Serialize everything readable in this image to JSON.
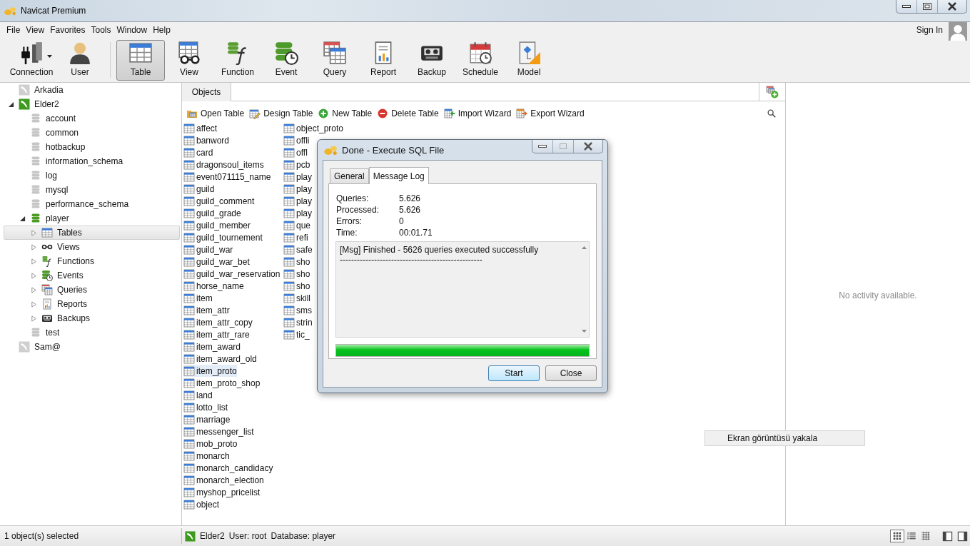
{
  "window": {
    "title": "Navicat Premium"
  },
  "menu": [
    "File",
    "View",
    "Favorites",
    "Tools",
    "Window",
    "Help"
  ],
  "account": {
    "label": "Sign In"
  },
  "toolbar": [
    {
      "kind": "connection",
      "label": "Connection",
      "selected": false,
      "dropdown": true
    },
    {
      "kind": "user",
      "label": "User",
      "selected": false,
      "dropdown": false
    },
    {
      "kind": "table",
      "label": "Table",
      "selected": true,
      "dropdown": false
    },
    {
      "kind": "view",
      "label": "View",
      "selected": false,
      "dropdown": false
    },
    {
      "kind": "function",
      "label": "Function",
      "selected": false,
      "dropdown": false
    },
    {
      "kind": "event",
      "label": "Event",
      "selected": false,
      "dropdown": false
    },
    {
      "kind": "query",
      "label": "Query",
      "selected": false,
      "dropdown": false
    },
    {
      "kind": "report",
      "label": "Report",
      "selected": false,
      "dropdown": false
    },
    {
      "kind": "backup",
      "label": "Backup",
      "selected": false,
      "dropdown": false
    },
    {
      "kind": "schedule",
      "label": "Schedule",
      "selected": false,
      "dropdown": false
    },
    {
      "kind": "model",
      "label": "Model",
      "selected": false,
      "dropdown": false
    }
  ],
  "tree": [
    {
      "kind": "server",
      "label": "Arkadia",
      "open": false,
      "selected": false
    },
    {
      "kind": "server",
      "label": "Elder2",
      "open": true,
      "expanded": true,
      "selected": false,
      "children": [
        {
          "kind": "database",
          "label": "account",
          "open": false,
          "selected": false
        },
        {
          "kind": "database",
          "label": "common",
          "open": false,
          "selected": false
        },
        {
          "kind": "database",
          "label": "hotbackup",
          "open": false,
          "selected": false
        },
        {
          "kind": "database",
          "label": "information_schema",
          "open": false,
          "selected": false
        },
        {
          "kind": "database",
          "label": "log",
          "open": false,
          "selected": false
        },
        {
          "kind": "database",
          "label": "mysql",
          "open": false,
          "selected": false
        },
        {
          "kind": "database",
          "label": "performance_schema",
          "open": false,
          "selected": false
        },
        {
          "kind": "database",
          "label": "player",
          "open": true,
          "expanded": true,
          "selected": false,
          "children": [
            {
              "kind": "tables",
              "label": "Tables",
              "expanded": false,
              "selected": true
            },
            {
              "kind": "views",
              "label": "Views",
              "expanded": false,
              "selected": false
            },
            {
              "kind": "functions",
              "label": "Functions",
              "expanded": false,
              "selected": false
            },
            {
              "kind": "events",
              "label": "Events",
              "expanded": false,
              "selected": false
            },
            {
              "kind": "queries",
              "label": "Queries",
              "expanded": false,
              "selected": false
            },
            {
              "kind": "reports",
              "label": "Reports",
              "expanded": false,
              "selected": false
            },
            {
              "kind": "backups",
              "label": "Backups",
              "expanded": false,
              "selected": false
            }
          ]
        },
        {
          "kind": "database",
          "label": "test",
          "open": false,
          "selected": false
        }
      ]
    },
    {
      "kind": "server",
      "label": "Sam@",
      "open": false,
      "selected": false
    }
  ],
  "objects_tab": {
    "label": "Objects"
  },
  "object_actions": [
    {
      "kind": "open",
      "label": "Open Table"
    },
    {
      "kind": "design",
      "label": "Design Table"
    },
    {
      "kind": "new",
      "label": "New Table"
    },
    {
      "kind": "delete",
      "label": "Delete Table"
    },
    {
      "kind": "import",
      "label": "Import Wizard"
    },
    {
      "kind": "export",
      "label": "Export Wizard"
    }
  ],
  "tables": {
    "columns": [
      [
        {
          "name": "affect",
          "selected": false
        },
        {
          "name": "banword",
          "selected": false
        },
        {
          "name": "card",
          "selected": false
        },
        {
          "name": "dragonsoul_items",
          "selected": false
        },
        {
          "name": "event071115_name",
          "selected": false
        },
        {
          "name": "guild",
          "selected": false
        },
        {
          "name": "guild_comment",
          "selected": false
        },
        {
          "name": "guild_grade",
          "selected": false
        },
        {
          "name": "guild_member",
          "selected": false
        },
        {
          "name": "guild_tournement",
          "selected": false
        },
        {
          "name": "guild_war",
          "selected": false
        },
        {
          "name": "guild_war_bet",
          "selected": false
        },
        {
          "name": "guild_war_reservation",
          "selected": false
        },
        {
          "name": "horse_name",
          "selected": false
        },
        {
          "name": "item",
          "selected": false
        },
        {
          "name": "item_attr",
          "selected": false
        },
        {
          "name": "item_attr_copy",
          "selected": false
        },
        {
          "name": "item_attr_rare",
          "selected": false
        },
        {
          "name": "item_award",
          "selected": false
        },
        {
          "name": "item_award_old",
          "selected": false
        },
        {
          "name": "item_proto",
          "selected": true
        },
        {
          "name": "item_proto_shop",
          "selected": false
        },
        {
          "name": "land",
          "selected": false
        },
        {
          "name": "lotto_list",
          "selected": false
        },
        {
          "name": "marriage",
          "selected": false
        },
        {
          "name": "messenger_list",
          "selected": false
        },
        {
          "name": "mob_proto",
          "selected": false
        },
        {
          "name": "monarch",
          "selected": false
        },
        {
          "name": "monarch_candidacy",
          "selected": false
        },
        {
          "name": "monarch_election",
          "selected": false
        },
        {
          "name": "myshop_pricelist",
          "selected": false
        },
        {
          "name": "object",
          "selected": false
        }
      ],
      [
        {
          "name": "object_proto",
          "selected": false
        },
        {
          "name": "offli",
          "selected": false
        },
        {
          "name": "offl",
          "selected": false
        },
        {
          "name": "pcb",
          "selected": false
        },
        {
          "name": "play",
          "selected": false
        },
        {
          "name": "play",
          "selected": false
        },
        {
          "name": "play",
          "selected": false
        },
        {
          "name": "play",
          "selected": false
        },
        {
          "name": "que",
          "selected": false
        },
        {
          "name": "refi",
          "selected": false
        },
        {
          "name": "safe",
          "selected": false
        },
        {
          "name": "sho",
          "selected": false
        },
        {
          "name": "sho",
          "selected": false
        },
        {
          "name": "sho",
          "selected": false
        },
        {
          "name": "skill",
          "selected": false
        },
        {
          "name": "sms",
          "selected": false
        },
        {
          "name": "strin",
          "selected": false
        },
        {
          "name": "tic_",
          "selected": false
        }
      ]
    ]
  },
  "activity": {
    "message": "No activity available."
  },
  "tooltip": {
    "text": "Ekran görüntüsü yakala"
  },
  "dialog": {
    "title": "Done - Execute SQL File",
    "tabs": [
      {
        "label": "General",
        "selected": false
      },
      {
        "label": "Message Log",
        "selected": true
      }
    ],
    "stats": [
      {
        "label": "Queries:",
        "value": "5.626"
      },
      {
        "label": "Processed:",
        "value": "5.626"
      },
      {
        "label": "Errors:",
        "value": "0"
      },
      {
        "label": "Time:",
        "value": "00:01.71"
      }
    ],
    "log": [
      "[Msg] Finished - 5626 queries executed successfully",
      "--------------------------------------------------"
    ],
    "progress": {
      "level": 1
    },
    "buttons": [
      {
        "label": "Start",
        "default": true
      },
      {
        "label": "Close",
        "default": false
      }
    ]
  },
  "status_bar": {
    "selection": "1 object(s) selected",
    "server": "Elder2",
    "user": "User: root",
    "database": "Database: player",
    "view_modes": [
      {
        "kind": "icons",
        "selected": true
      },
      {
        "kind": "list",
        "selected": false
      },
      {
        "kind": "detail",
        "selected": false
      }
    ]
  }
}
